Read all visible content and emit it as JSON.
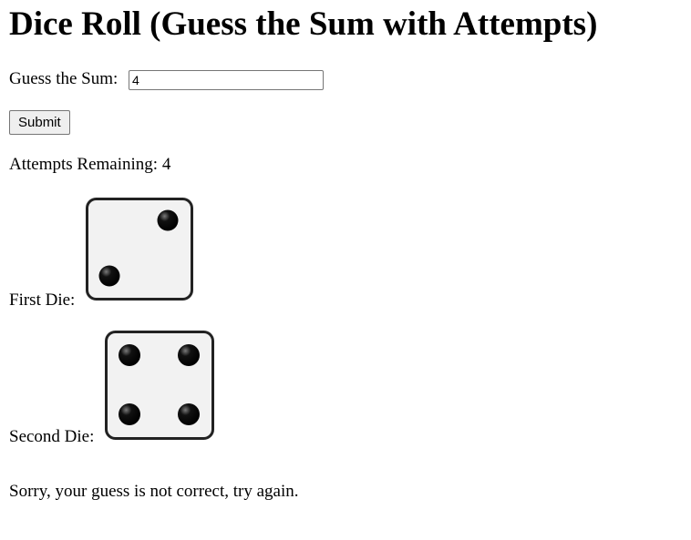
{
  "heading": "Dice Roll (Guess the Sum with Attempts)",
  "guess": {
    "label": "Guess the Sum:",
    "value": "4"
  },
  "submit_label": "Submit",
  "attempts": {
    "label": "Attempts Remaining:",
    "value": "4"
  },
  "first_die": {
    "label": "First Die:",
    "face": 2
  },
  "second_die": {
    "label": "Second Die:",
    "face": 4
  },
  "message": "Sorry, your guess is not correct, try again.",
  "colors": {
    "die_face": "#f2f2f2",
    "die_border": "#222222",
    "pip": "#000000"
  },
  "icons": {
    "first_die": "dice-two-icon",
    "second_die": "dice-four-icon"
  }
}
